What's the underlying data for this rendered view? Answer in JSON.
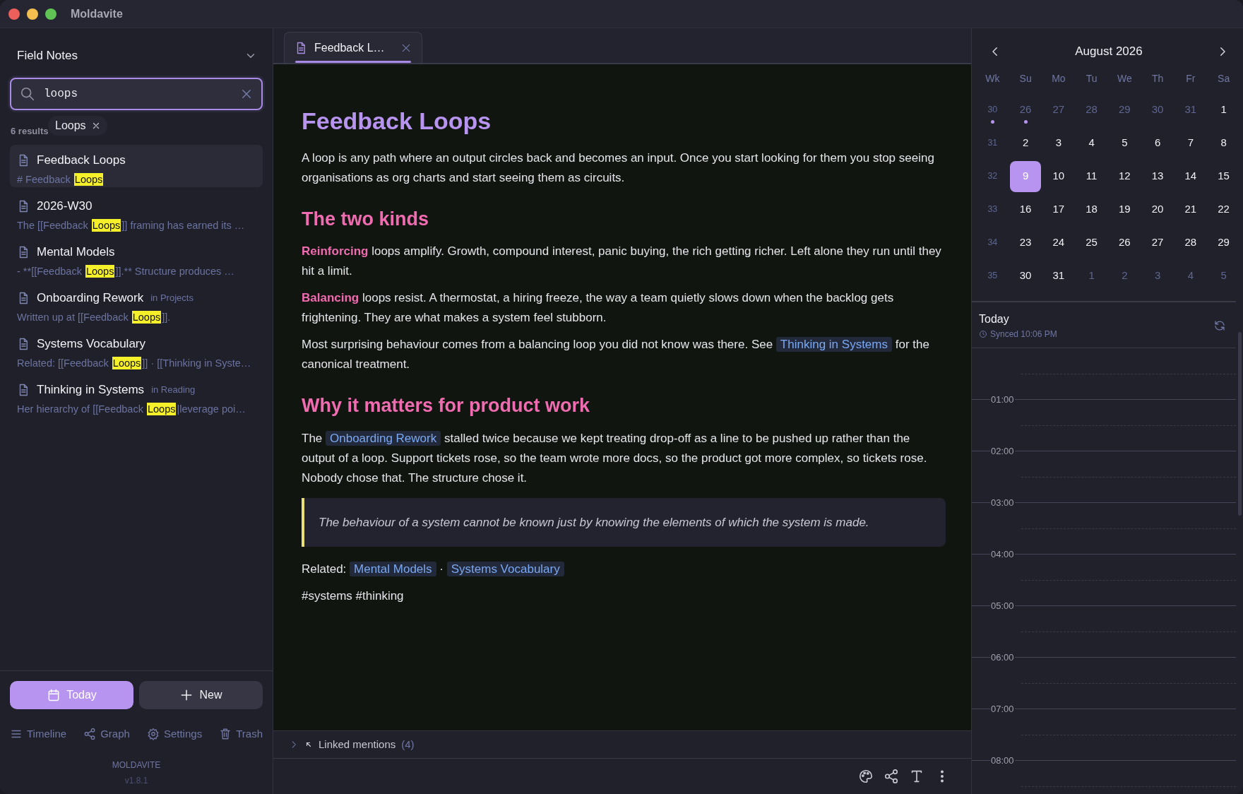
{
  "window": {
    "title": "Moldavite"
  },
  "sidebar": {
    "notebook": "Field Notes",
    "search": {
      "value": "loops"
    },
    "suggestion": "Loops",
    "results_count": "6 results",
    "results": [
      {
        "title": "Feedback Loops",
        "before": "# Feedback ",
        "match": "Loops",
        "selected": true
      },
      {
        "title": "2026-W30",
        "before": "The [[Feedback ",
        "match": "Loops",
        "after": "]] framing has earned its …",
        "selected": false
      },
      {
        "title": "Mental Models",
        "before": "- **[[Feedback ",
        "match": "Loops",
        "after": "]].** Structure produces …",
        "selected": false
      },
      {
        "title": "Onboarding Rework",
        "folder": "in Projects",
        "before": "Written up at [[Feedback ",
        "match": "Loops",
        "after": "]].",
        "selected": false
      },
      {
        "title": "Systems Vocabulary",
        "before": "Related: [[Feedback ",
        "match": "Loops",
        "after": "]] · [[Thinking in Syste…",
        "selected": false
      },
      {
        "title": "Thinking in Systems",
        "folder": "in Reading",
        "before": "Her hierarchy of [[Feedback ",
        "match": "Loops",
        "after": "|leverage poi…",
        "selected": false
      }
    ],
    "actions": [
      {
        "label": "Today",
        "kind": "primary"
      },
      {
        "label": "New",
        "kind": "secondary"
      }
    ],
    "nav": [
      "Timeline",
      "Graph",
      "Settings",
      "Trash"
    ],
    "app_name": "MOLDAVITE",
    "version": "v1.8.1"
  },
  "editor": {
    "tabs": [
      {
        "label": "Feedback L…",
        "selected": true
      }
    ],
    "title": "Feedback Loops",
    "blocks": [
      {
        "kind": "paragraph",
        "parts": [
          {
            "kind": "text",
            "text": "A loop is any path where an output circles back and becomes an input. Once you start looking for them you stop seeing organisations as org charts and start seeing them as circuits."
          }
        ]
      },
      {
        "kind": "heading",
        "text": "The two kinds"
      },
      {
        "kind": "paragraph",
        "parts": [
          {
            "kind": "term",
            "text": "Reinforcing"
          },
          {
            "kind": "text",
            "text": " loops amplify. Growth, compound interest, panic buying, the rich getting richer. Left alone they run until they hit a limit."
          }
        ]
      },
      {
        "kind": "paragraph",
        "parts": [
          {
            "kind": "term",
            "text": "Balancing"
          },
          {
            "kind": "text",
            "text": " loops resist. A thermostat, a hiring freeze, the way a team quietly slows down when the backlog gets frightening. They are what makes a system feel stubborn."
          }
        ]
      },
      {
        "kind": "paragraph",
        "parts": [
          {
            "kind": "text",
            "text": "Most surprising behaviour comes from a balancing loop you did not know was there. See "
          },
          {
            "kind": "link",
            "text": "Thinking in Systems"
          },
          {
            "kind": "text",
            "text": " for the canonical treatment."
          }
        ]
      },
      {
        "kind": "heading",
        "text": "Why it matters for product work"
      },
      {
        "kind": "paragraph",
        "parts": [
          {
            "kind": "text",
            "text": "The "
          },
          {
            "kind": "link",
            "text": "Onboarding Rework"
          },
          {
            "kind": "text",
            "text": " stalled twice because we kept treating drop-off as a line to be pushed up rather than the output of a loop. Support tickets rose, so the team wrote more docs, so the product got more complex, so tickets rose. Nobody chose that. The structure chose it."
          }
        ]
      },
      {
        "kind": "quote",
        "text": "The behaviour of a system cannot be known just by knowing the elements of which the system is made."
      },
      {
        "kind": "paragraph",
        "parts": [
          {
            "kind": "text",
            "text": "Related: "
          },
          {
            "kind": "link",
            "text": "Mental Models"
          },
          {
            "kind": "text",
            "text": " · "
          },
          {
            "kind": "link",
            "text": "Systems Vocabulary"
          }
        ]
      },
      {
        "kind": "paragraph",
        "parts": [
          {
            "kind": "text",
            "text": "#systems #thinking"
          }
        ]
      }
    ],
    "linked_mentions": {
      "label": "Linked mentions",
      "count": "(4)",
      "expanded": false
    }
  },
  "calendar": {
    "month": "August 2026",
    "headers": [
      "Wk",
      "Su",
      "Mo",
      "Tu",
      "We",
      "Th",
      "Fr",
      "Sa"
    ],
    "weeks": [
      {
        "week": "30",
        "has_entry": true,
        "days": [
          {
            "day": "26",
            "outside": true,
            "has_entry": true,
            "selected": false
          },
          {
            "day": "27",
            "outside": true,
            "has_entry": false,
            "selected": false
          },
          {
            "day": "28",
            "outside": true,
            "has_entry": false,
            "selected": false
          },
          {
            "day": "29",
            "outside": true,
            "has_entry": false,
            "selected": false
          },
          {
            "day": "30",
            "outside": true,
            "has_entry": false,
            "selected": false
          },
          {
            "day": "31",
            "outside": true,
            "has_entry": false,
            "selected": false
          },
          {
            "day": "1",
            "outside": false,
            "has_entry": false,
            "selected": false
          }
        ]
      },
      {
        "week": "31",
        "has_entry": false,
        "days": [
          {
            "day": "2",
            "outside": false,
            "has_entry": false,
            "selected": false
          },
          {
            "day": "3",
            "outside": false,
            "has_entry": false,
            "selected": false
          },
          {
            "day": "4",
            "outside": false,
            "has_entry": false,
            "selected": false
          },
          {
            "day": "5",
            "outside": false,
            "has_entry": false,
            "selected": false
          },
          {
            "day": "6",
            "outside": false,
            "has_entry": false,
            "selected": false
          },
          {
            "day": "7",
            "outside": false,
            "has_entry": false,
            "selected": false
          },
          {
            "day": "8",
            "outside": false,
            "has_entry": false,
            "selected": false
          }
        ]
      },
      {
        "week": "32",
        "has_entry": false,
        "days": [
          {
            "day": "9",
            "outside": false,
            "has_entry": false,
            "selected": true
          },
          {
            "day": "10",
            "outside": false,
            "has_entry": false,
            "selected": false
          },
          {
            "day": "11",
            "outside": false,
            "has_entry": false,
            "selected": false
          },
          {
            "day": "12",
            "outside": false,
            "has_entry": false,
            "selected": false
          },
          {
            "day": "13",
            "outside": false,
            "has_entry": false,
            "selected": false
          },
          {
            "day": "14",
            "outside": false,
            "has_entry": false,
            "selected": false
          },
          {
            "day": "15",
            "outside": false,
            "has_entry": false,
            "selected": false
          }
        ]
      },
      {
        "week": "33",
        "has_entry": false,
        "days": [
          {
            "day": "16",
            "outside": false,
            "has_entry": false,
            "selected": false
          },
          {
            "day": "17",
            "outside": false,
            "has_entry": false,
            "selected": false
          },
          {
            "day": "18",
            "outside": false,
            "has_entry": false,
            "selected": false
          },
          {
            "day": "19",
            "outside": false,
            "has_entry": false,
            "selected": false
          },
          {
            "day": "20",
            "outside": false,
            "has_entry": false,
            "selected": false
          },
          {
            "day": "21",
            "outside": false,
            "has_entry": false,
            "selected": false
          },
          {
            "day": "22",
            "outside": false,
            "has_entry": false,
            "selected": false
          }
        ]
      },
      {
        "week": "34",
        "has_entry": false,
        "days": [
          {
            "day": "23",
            "outside": false,
            "has_entry": false,
            "selected": false
          },
          {
            "day": "24",
            "outside": false,
            "has_entry": false,
            "selected": false
          },
          {
            "day": "25",
            "outside": false,
            "has_entry": false,
            "selected": false
          },
          {
            "day": "26",
            "outside": false,
            "has_entry": false,
            "selected": false
          },
          {
            "day": "27",
            "outside": false,
            "has_entry": false,
            "selected": false
          },
          {
            "day": "28",
            "outside": false,
            "has_entry": false,
            "selected": false
          },
          {
            "day": "29",
            "outside": false,
            "has_entry": false,
            "selected": false
          }
        ]
      },
      {
        "week": "35",
        "has_entry": false,
        "days": [
          {
            "day": "30",
            "outside": false,
            "has_entry": false,
            "selected": false
          },
          {
            "day": "31",
            "outside": false,
            "has_entry": false,
            "selected": false
          },
          {
            "day": "1",
            "outside": true,
            "has_entry": false,
            "selected": false
          },
          {
            "day": "2",
            "outside": true,
            "has_entry": false,
            "selected": false
          },
          {
            "day": "3",
            "outside": true,
            "has_entry": false,
            "selected": false
          },
          {
            "day": "4",
            "outside": true,
            "has_entry": false,
            "selected": false
          },
          {
            "day": "5",
            "outside": true,
            "has_entry": false,
            "selected": false
          }
        ]
      }
    ]
  },
  "day_view": {
    "title": "Today",
    "synced": "Synced 10:06 PM",
    "hours": [
      "01:00",
      "02:00",
      "03:00",
      "04:00",
      "05:00",
      "06:00",
      "07:00",
      "08:00"
    ]
  }
}
